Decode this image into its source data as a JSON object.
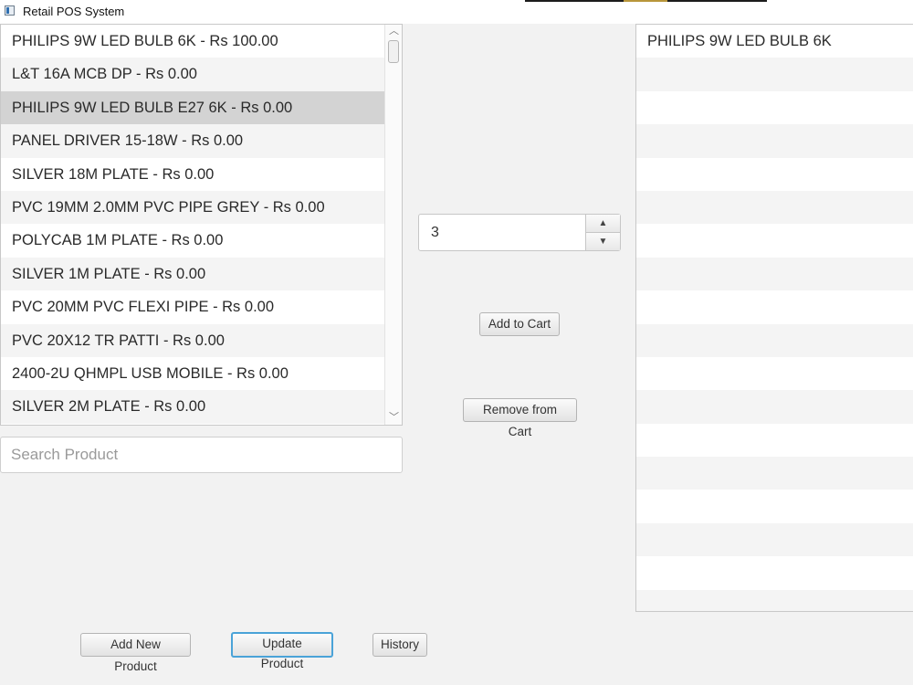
{
  "window": {
    "title": "Retail POS System"
  },
  "products": {
    "items": [
      "PHILIPS 9W LED BULB 6K - Rs 100.00",
      "L&T 16A MCB DP - Rs 0.00",
      "PHILIPS 9W LED BULB E27 6K - Rs 0.00",
      "PANEL DRIVER 15-18W - Rs 0.00",
      "SILVER 18M PLATE - Rs 0.00",
      "PVC 19MM 2.0MM PVC PIPE GREY - Rs 0.00",
      "POLYCAB 1M PLATE - Rs 0.00",
      "SILVER 1M PLATE - Rs 0.00",
      "PVC 20MM PVC FLEXI PIPE - Rs 0.00",
      "PVC 20X12 TR PATTI - Rs 0.00",
      "2400-2U QHMPL USB MOBILE - Rs 0.00",
      "SILVER 2M PLATE - Rs 0.00"
    ],
    "selected_index": 2
  },
  "search": {
    "placeholder": "Search Product",
    "value": ""
  },
  "quantity": {
    "value": "3"
  },
  "actions": {
    "add_to_cart": "Add to Cart",
    "remove_from_cart": "Remove from Cart"
  },
  "cart": {
    "items": [
      "PHILIPS 9W LED BULB 6K"
    ]
  },
  "footer": {
    "add_new_product": "Add New Product",
    "update_product": "Update Product",
    "history": "History"
  }
}
